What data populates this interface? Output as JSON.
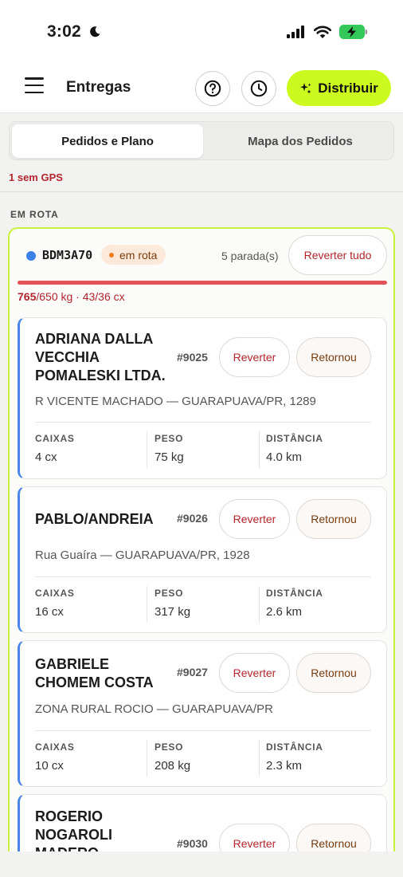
{
  "status_bar": {
    "time": "3:02",
    "icons": [
      "moon-icon",
      "signal-icon",
      "wifi-icon",
      "battery-charging-icon"
    ]
  },
  "header": {
    "title": "Entregas",
    "distribuir_label": "Distribuir",
    "accent": "#cdfa1e"
  },
  "tabs": [
    {
      "label": "Pedidos e Plano",
      "active": true
    },
    {
      "label": "Mapa dos Pedidos",
      "active": false
    }
  ],
  "gps_warning": "1 sem GPS",
  "section_label": "EM ROTA",
  "route": {
    "plate": "BDM3A70",
    "status": "em rota",
    "stops": "5 parada(s)",
    "revert_all_label": "Reverter tudo",
    "weight_used": "765",
    "capacity_rest": "/650 kg · 43/36 cx",
    "load_fraction": 1.0
  },
  "labels": {
    "reverter": "Reverter",
    "retornou": "Retornou",
    "caixas": "CAIXAS",
    "peso": "PESO",
    "distancia": "DISTÂNCIA"
  },
  "orders": [
    {
      "name": "ADRIANA DALLA VECCHIA POMALESKI LTDA.",
      "id": "#9025",
      "address": "R VICENTE MACHADO — GUARAPUAVA/PR, 1289",
      "caixas": "4 cx",
      "peso": "75 kg",
      "distancia": "4.0 km"
    },
    {
      "name": "PABLO/ANDREIA",
      "id": "#9026",
      "address": "Rua Guaíra — GUARAPUAVA/PR, 1928",
      "caixas": "16 cx",
      "peso": "317 kg",
      "distancia": "2.6 km"
    },
    {
      "name": "GABRIELE CHOMEM COSTA",
      "id": "#9027",
      "address": "ZONA RURAL ROCIO — GUARAPUAVA/PR",
      "caixas": "10 cx",
      "peso": "208 kg",
      "distancia": "2.3 km"
    },
    {
      "name": "ROGERIO NOGAROLI MADERO",
      "id": "#9030"
    }
  ]
}
